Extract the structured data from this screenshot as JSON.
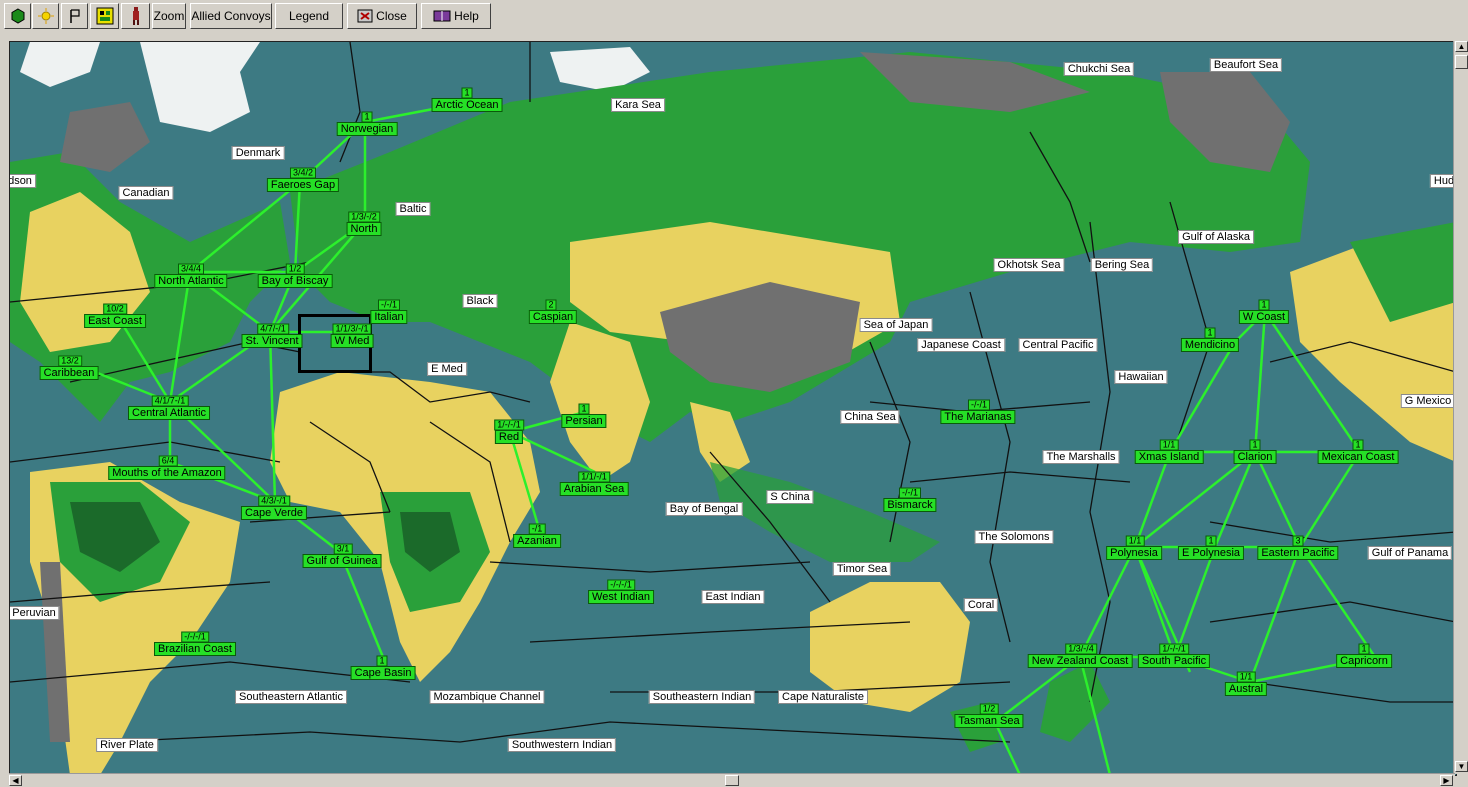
{
  "toolbar": {
    "buttons": [
      {
        "name": "hex-icon",
        "label": ""
      },
      {
        "name": "sun-icon",
        "label": ""
      },
      {
        "name": "flag-icon",
        "label": ""
      },
      {
        "name": "grid-icon",
        "label": ""
      },
      {
        "name": "soldier-icon",
        "label": ""
      },
      {
        "name": "zoom",
        "label": "Zoom"
      },
      {
        "name": "allied-convoys",
        "label": "Allied Convoys"
      },
      {
        "name": "legend",
        "label": "Legend"
      },
      {
        "name": "close",
        "label": "Close"
      },
      {
        "name": "help",
        "label": "Help"
      }
    ]
  },
  "sea_zones": [
    {
      "name": "Kara Sea"
    },
    {
      "name": "Chukchi Sea"
    },
    {
      "name": "Beaufort Sea"
    },
    {
      "name": "Denmark"
    },
    {
      "name": "dson"
    },
    {
      "name": "Canadian"
    },
    {
      "name": "Baltic"
    },
    {
      "name": "Hud"
    },
    {
      "name": "Gulf of Alaska"
    },
    {
      "name": "Okhotsk Sea"
    },
    {
      "name": "Bering Sea"
    },
    {
      "name": "Black"
    },
    {
      "name": "Sea of Japan"
    },
    {
      "name": "Japanese Coast"
    },
    {
      "name": "Central Pacific"
    },
    {
      "name": "E Med"
    },
    {
      "name": "Hawaiian"
    },
    {
      "name": "G Mexico"
    },
    {
      "name": "China Sea"
    },
    {
      "name": "The Marshalls"
    },
    {
      "name": "S China"
    },
    {
      "name": "Bay of Bengal"
    },
    {
      "name": "The Solomons"
    },
    {
      "name": "Gulf of Panama"
    },
    {
      "name": "Timor Sea"
    },
    {
      "name": "Peruvian"
    },
    {
      "name": "East Indian"
    },
    {
      "name": "Coral"
    },
    {
      "name": "Southeastern Atlantic"
    },
    {
      "name": "Mozambique Channel"
    },
    {
      "name": "Southeastern Indian"
    },
    {
      "name": "Cape Naturaliste"
    },
    {
      "name": "River Plate"
    },
    {
      "name": "Southwestern Indian"
    }
  ],
  "convoy_zones": [
    {
      "name": "Arctic Ocean",
      "code": "1"
    },
    {
      "name": "Norwegian",
      "code": "1"
    },
    {
      "name": "Faeroes Gap",
      "code": "3/4/2"
    },
    {
      "name": "North",
      "code": "1/3/-/2"
    },
    {
      "name": "North Atlantic",
      "code": "3/4/4"
    },
    {
      "name": "Bay of Biscay",
      "code": "1/2"
    },
    {
      "name": "Italian",
      "code": "-/-/1"
    },
    {
      "name": "Caspian",
      "code": "2"
    },
    {
      "name": "East Coast",
      "code": "10/2"
    },
    {
      "name": "St. Vincent",
      "code": "4/7/-/1"
    },
    {
      "name": "W Med",
      "code": "1/1/3/-/1"
    },
    {
      "name": "Caribbean",
      "code": "13/2"
    },
    {
      "name": "Central Atlantic",
      "code": "4/1/7-/1"
    },
    {
      "name": "Persian",
      "code": "1"
    },
    {
      "name": "Red",
      "code": "1/-/-/1"
    },
    {
      "name": "Mouths of the Amazon",
      "code": "6/4"
    },
    {
      "name": "Arabian Sea",
      "code": "1/1/-/1"
    },
    {
      "name": "Cape Verde",
      "code": "4/3/-/1"
    },
    {
      "name": "Azanian",
      "code": "-/1"
    },
    {
      "name": "Gulf of Guinea",
      "code": "3/1"
    },
    {
      "name": "West Indian",
      "code": "-/-/-/1"
    },
    {
      "name": "Brazilian Coast",
      "code": "-/-/-/1"
    },
    {
      "name": "Cape Basin",
      "code": "1"
    },
    {
      "name": "The Marianas",
      "code": "-/-/1"
    },
    {
      "name": "Bismarck",
      "code": "-/-/1"
    },
    {
      "name": "W Coast",
      "code": "1"
    },
    {
      "name": "Mendicino",
      "code": "1"
    },
    {
      "name": "Xmas Island",
      "code": "1/1"
    },
    {
      "name": "Clarion",
      "code": "1"
    },
    {
      "name": "Mexican Coast",
      "code": "1"
    },
    {
      "name": "Polynesia",
      "code": "1/1"
    },
    {
      "name": "E Polynesia",
      "code": "1"
    },
    {
      "name": "Eastern Pacific",
      "code": "3"
    },
    {
      "name": "New Zealand Coast",
      "code": "1/3/-/4"
    },
    {
      "name": "South Pacific",
      "code": "1/-/-/1"
    },
    {
      "name": "Capricorn",
      "code": "1"
    },
    {
      "name": "Austral",
      "code": "1/1"
    },
    {
      "name": "Tasman Sea",
      "code": "1/2"
    }
  ],
  "colors": {
    "ocean": "#3d7a83",
    "land_yellow": "#e8d260",
    "land_green": "#2aa03a",
    "land_dark_green": "#1b6a2a",
    "mountain": "#707070",
    "ice": "#f0f0f0",
    "convoy_route": "#2cf02c",
    "label_bg": "#ffffff",
    "convoy_bg": "#26e026"
  }
}
